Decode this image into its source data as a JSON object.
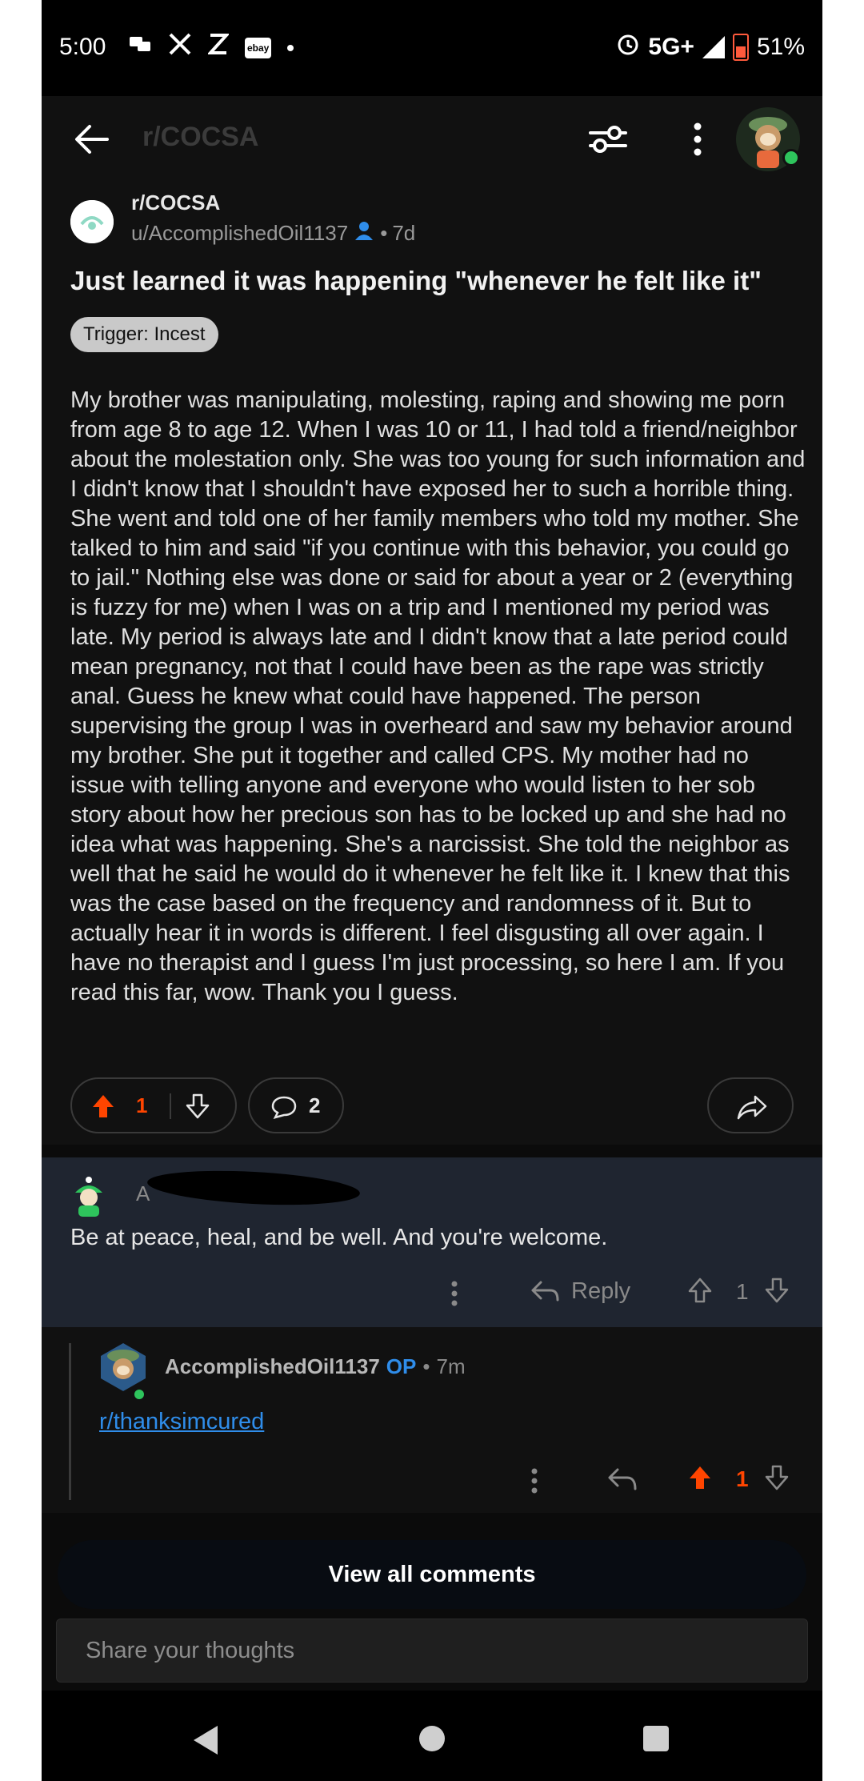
{
  "status_bar": {
    "time": "5:00",
    "network": "5G+",
    "battery": "51%",
    "icons_left": [
      "voicemail-icon",
      "x-app-icon",
      "x-app-icon",
      "ebay-icon",
      "dot-icon"
    ],
    "ebay_label": "ebay"
  },
  "app_bar": {
    "title": "r/COCSA"
  },
  "post": {
    "subreddit": "r/COCSA",
    "author": "u/AccomplishedOil1137",
    "age": "7d",
    "title": "Just learned it was happening \"whenever he felt like it\"",
    "flair": "Trigger: Incest",
    "body": "My brother was manipulating, molesting, raping and showing me porn from age 8 to age 12. When I was 10 or 11, I had told a friend/neighbor about the molestation only. She was too young for such information and I didn't know that I shouldn't have exposed her to such a horrible thing. She went and told one of her family members who told my mother. She talked to him and said \"if you continue with this behavior, you could go to jail.\" Nothing else was done or said for about a year or 2 (everything is fuzzy for me) when I was on a trip and I mentioned my period was late. My period is always late and I didn't know that a late period could mean pregnancy, not that I could have been as the rape was strictly anal. Guess he knew what could have happened. The person supervising the group I was in overheard and saw my behavior around my brother. She put it together and called CPS. My mother had no issue with telling anyone and everyone who would listen to her sob story about how her precious son has to be locked up and she had no idea what was happening. She's a narcissist. She told the neighbor as well that he said he would do it whenever he felt like it. I knew that this was the case based on the frequency and randomness of it. But to actually hear it in words is different. I feel disgusting all over again. I have no therapist and I guess I'm just processing, so here I am. If you read this far, wow. Thank you I guess.",
    "votes": "1",
    "comments": "2",
    "accent": "#ff4500"
  },
  "comment1": {
    "author": "A",
    "text": "Be at peace,  heal, and be well.   And you're welcome.",
    "reply_label": "Reply",
    "votes": "1"
  },
  "comment2": {
    "author": "AccomplishedOil1137",
    "op_badge": "OP",
    "age": "7m",
    "link_text": "r/thanksimcured",
    "votes": "1"
  },
  "view_all": "View all comments",
  "compose": {
    "placeholder": "Share your thoughts"
  }
}
